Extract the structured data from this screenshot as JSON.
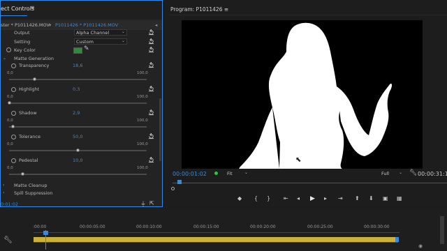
{
  "effect_controls": {
    "title": "ect Controls",
    "menu_icon": "hamburger-icon",
    "master_clip": "ster * P1011426.MOV",
    "clip_separator": "▾",
    "active_clip": "P1011426 * P1011426.MOV",
    "collapse_icon": "◂",
    "output": {
      "label": "Output",
      "value": "Alpha Channel"
    },
    "setting": {
      "label": "Setting",
      "value": "Custom"
    },
    "key_color": {
      "label": "Key Color",
      "swatch_color": "#2e8b3e"
    },
    "matte_generation": "Matte Generation",
    "sliders": [
      {
        "label": "Transparency",
        "value": "18,6",
        "min": "0,0",
        "max": "100,0",
        "position": 0.186
      },
      {
        "label": "Highlight",
        "value": "0,3",
        "min": "0,0",
        "max": "100,0",
        "position": 0.003
      },
      {
        "label": "Shadow",
        "value": "2,9",
        "min": "0,0",
        "max": "100,0",
        "position": 0.029
      },
      {
        "label": "Tolerance",
        "value": "50,0",
        "min": "0,0",
        "max": "100,0",
        "position": 0.5
      },
      {
        "label": "Pedestal",
        "value": "10,0",
        "min": "0,0",
        "max": "100,0",
        "position": 0.1
      }
    ],
    "matte_cleanup": "Matte Cleanup",
    "spill_suppression": "Spill Suppression",
    "timecode": "0:01:02"
  },
  "program_monitor": {
    "title": "Program: P1011426",
    "menu_icon": "≡",
    "timecode": "00:00:01:02",
    "fit": "Fit",
    "quality": "Full",
    "duration": "00:00:31:1",
    "buttons": [
      "marker-icon",
      "in-point-icon",
      "out-point-icon",
      "go-to-in-icon",
      "step-back-icon",
      "play-icon",
      "step-forward-icon",
      "go-to-out-icon",
      "lift-icon",
      "extract-icon",
      "export-frame-icon",
      "comparison-icon"
    ],
    "button_glyphs": [
      "◆",
      "{",
      "}",
      "⇤",
      "◂",
      "▶",
      "▸",
      "⇥",
      "⬆",
      "⬇",
      "▣",
      "▦"
    ]
  },
  "timeline": {
    "ruler": [
      ":00:00",
      "00:00:05:00",
      "00:00:10:00",
      "00:00:15:00",
      "00:00:20:00",
      "00:00:25:00",
      "00:00:30:00"
    ],
    "playhead_fraction": 0.033,
    "clip_color": "#c9b13c"
  },
  "colors": {
    "accent": "#2d8ceb",
    "value_blue": "#3b8ad8",
    "timecode_blue": "#3b8ad8",
    "green_dot": "#27c93f"
  }
}
